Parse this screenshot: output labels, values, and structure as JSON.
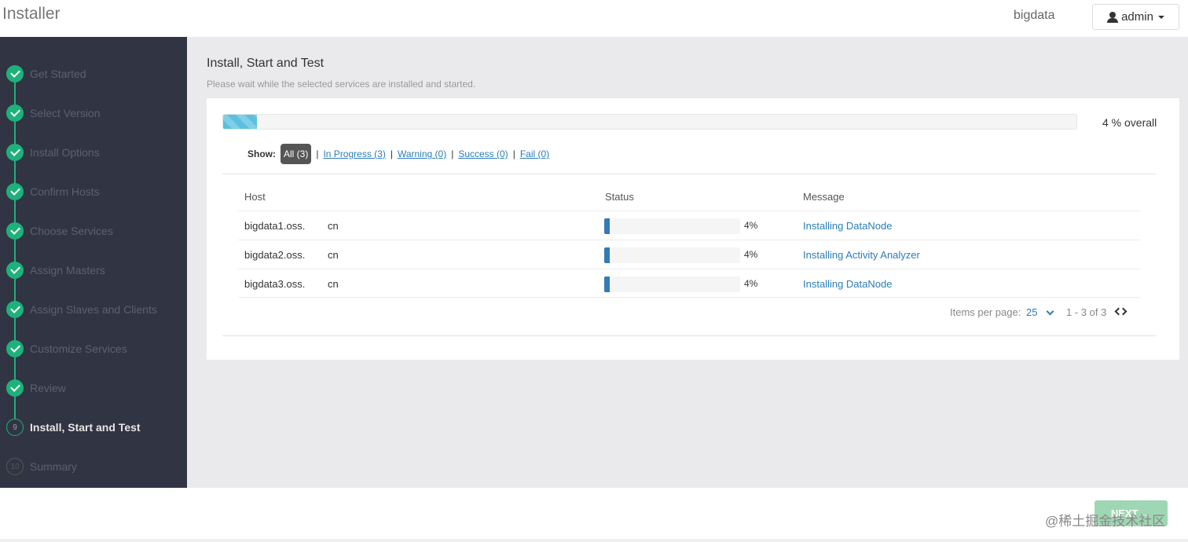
{
  "header": {
    "app_title": "Installer",
    "cluster_name": "bigdata",
    "user_menu_label": "admin"
  },
  "sidebar": {
    "steps": [
      {
        "label": "Get Started",
        "state": "done"
      },
      {
        "label": "Select Version",
        "state": "done"
      },
      {
        "label": "Install Options",
        "state": "done"
      },
      {
        "label": "Confirm Hosts",
        "state": "done"
      },
      {
        "label": "Choose Services",
        "state": "done"
      },
      {
        "label": "Assign Masters",
        "state": "done"
      },
      {
        "label": "Assign Slaves and Clients",
        "state": "done"
      },
      {
        "label": "Customize Services",
        "state": "done"
      },
      {
        "label": "Review",
        "state": "done"
      },
      {
        "label": "Install, Start and Test",
        "state": "current",
        "number": "9"
      },
      {
        "label": "Summary",
        "state": "todo",
        "number": "10"
      }
    ]
  },
  "main": {
    "title": "Install, Start and Test",
    "subtitle": "Please wait while the selected services are installed and started.",
    "overall": {
      "progress_percent": 4,
      "label": "4 % overall"
    },
    "filters": {
      "show_label": "Show:",
      "all": "All (3)",
      "in_progress": "In Progress (3)",
      "warning": "Warning (0)",
      "success": "Success (0)",
      "fail": "Fail (0)",
      "separator": "|"
    },
    "table": {
      "headers": {
        "host": "Host",
        "status": "Status",
        "message": "Message"
      },
      "rows": [
        {
          "host": "bigdata1.oss.",
          "host_suffix": "cn",
          "progress": 4,
          "percent_label": "4%",
          "message": "Installing DataNode"
        },
        {
          "host": "bigdata2.oss.",
          "host_suffix": "cn",
          "progress": 4,
          "percent_label": "4%",
          "message": "Installing Activity Analyzer"
        },
        {
          "host": "bigdata3.oss.",
          "host_suffix": "cn",
          "progress": 4,
          "percent_label": "4%",
          "message": "Installing DataNode"
        }
      ]
    },
    "pagination": {
      "items_per_page_label": "Items per page:",
      "page_size": "25",
      "range": "1 - 3 of 3"
    }
  },
  "footer": {
    "next_label": "NEXT →",
    "watermark": "@稀土掘金技术社区"
  },
  "colors": {
    "sidebar_bg": "#313443",
    "step_done": "#1eb17a",
    "link": "#2a7eb8",
    "progress_row": "#337ab7",
    "progress_overall": "#5bc0de",
    "next_button_disabled": "#9fd6b3"
  }
}
